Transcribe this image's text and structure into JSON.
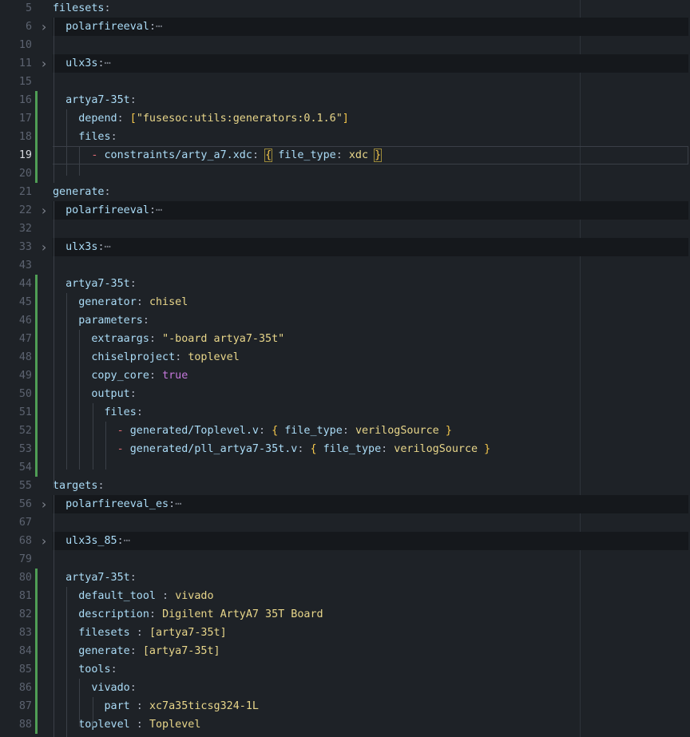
{
  "editor": {
    "lines": [
      {
        "num": "5",
        "tokens": [
          {
            "t": "key",
            "v": "filesets"
          },
          {
            "t": "punct",
            "v": ":"
          }
        ]
      },
      {
        "num": "6",
        "folded": true,
        "tokens": [
          {
            "t": "sp",
            "v": "  "
          },
          {
            "t": "key",
            "v": "polarfireeval"
          },
          {
            "t": "punct",
            "v": ":"
          },
          {
            "t": "ellipsis",
            "v": "⋯"
          }
        ]
      },
      {
        "num": "10",
        "tokens": []
      },
      {
        "num": "11",
        "folded": true,
        "tokens": [
          {
            "t": "sp",
            "v": "  "
          },
          {
            "t": "key",
            "v": "ulx3s"
          },
          {
            "t": "punct",
            "v": ":"
          },
          {
            "t": "ellipsis",
            "v": "⋯"
          }
        ]
      },
      {
        "num": "15",
        "tokens": []
      },
      {
        "num": "16",
        "tokens": [
          {
            "t": "sp",
            "v": "  "
          },
          {
            "t": "key",
            "v": "artya7-35t"
          },
          {
            "t": "punct",
            "v": ":"
          }
        ]
      },
      {
        "num": "17",
        "tokens": [
          {
            "t": "sp",
            "v": "    "
          },
          {
            "t": "key",
            "v": "depend"
          },
          {
            "t": "punct",
            "v": ": "
          },
          {
            "t": "brace",
            "v": "["
          },
          {
            "t": "str",
            "v": "\"fusesoc:utils:generators:0.1.6\""
          },
          {
            "t": "brace",
            "v": "]"
          }
        ]
      },
      {
        "num": "18",
        "tokens": [
          {
            "t": "sp",
            "v": "    "
          },
          {
            "t": "key",
            "v": "files"
          },
          {
            "t": "punct",
            "v": ":"
          }
        ]
      },
      {
        "num": "19",
        "current": true,
        "tokens": [
          {
            "t": "sp",
            "v": "      "
          },
          {
            "t": "dash",
            "v": "- "
          },
          {
            "t": "key",
            "v": "constraints/arty_a7.xdc"
          },
          {
            "t": "punct",
            "v": ": "
          },
          {
            "t": "bracebox",
            "v": "{"
          },
          {
            "t": "punct",
            "v": " "
          },
          {
            "t": "key",
            "v": "file_type"
          },
          {
            "t": "punct",
            "v": ": "
          },
          {
            "t": "val",
            "v": "xdc"
          },
          {
            "t": "punct",
            "v": " "
          },
          {
            "t": "bracebox",
            "v": "}"
          }
        ]
      },
      {
        "num": "20",
        "tokens": []
      },
      {
        "num": "21",
        "tokens": [
          {
            "t": "key",
            "v": "generate"
          },
          {
            "t": "punct",
            "v": ":"
          }
        ]
      },
      {
        "num": "22",
        "folded": true,
        "tokens": [
          {
            "t": "sp",
            "v": "  "
          },
          {
            "t": "key",
            "v": "polarfireeval"
          },
          {
            "t": "punct",
            "v": ":"
          },
          {
            "t": "ellipsis",
            "v": "⋯"
          }
        ]
      },
      {
        "num": "32",
        "tokens": []
      },
      {
        "num": "33",
        "folded": true,
        "tokens": [
          {
            "t": "sp",
            "v": "  "
          },
          {
            "t": "key",
            "v": "ulx3s"
          },
          {
            "t": "punct",
            "v": ":"
          },
          {
            "t": "ellipsis",
            "v": "⋯"
          }
        ]
      },
      {
        "num": "43",
        "tokens": []
      },
      {
        "num": "44",
        "tokens": [
          {
            "t": "sp",
            "v": "  "
          },
          {
            "t": "key",
            "v": "artya7-35t"
          },
          {
            "t": "punct",
            "v": ":"
          }
        ]
      },
      {
        "num": "45",
        "tokens": [
          {
            "t": "sp",
            "v": "    "
          },
          {
            "t": "key",
            "v": "generator"
          },
          {
            "t": "punct",
            "v": ": "
          },
          {
            "t": "val",
            "v": "chisel"
          }
        ]
      },
      {
        "num": "46",
        "tokens": [
          {
            "t": "sp",
            "v": "    "
          },
          {
            "t": "key",
            "v": "parameters"
          },
          {
            "t": "punct",
            "v": ":"
          }
        ]
      },
      {
        "num": "47",
        "tokens": [
          {
            "t": "sp",
            "v": "      "
          },
          {
            "t": "key",
            "v": "extraargs"
          },
          {
            "t": "punct",
            "v": ": "
          },
          {
            "t": "str",
            "v": "\"-board artya7-35t\""
          }
        ]
      },
      {
        "num": "48",
        "tokens": [
          {
            "t": "sp",
            "v": "      "
          },
          {
            "t": "key",
            "v": "chiselproject"
          },
          {
            "t": "punct",
            "v": ": "
          },
          {
            "t": "val",
            "v": "toplevel"
          }
        ]
      },
      {
        "num": "49",
        "tokens": [
          {
            "t": "sp",
            "v": "      "
          },
          {
            "t": "key",
            "v": "copy_core"
          },
          {
            "t": "punct",
            "v": ": "
          },
          {
            "t": "bool",
            "v": "true"
          }
        ]
      },
      {
        "num": "50",
        "tokens": [
          {
            "t": "sp",
            "v": "      "
          },
          {
            "t": "key",
            "v": "output"
          },
          {
            "t": "punct",
            "v": ":"
          }
        ]
      },
      {
        "num": "51",
        "tokens": [
          {
            "t": "sp",
            "v": "        "
          },
          {
            "t": "key",
            "v": "files"
          },
          {
            "t": "punct",
            "v": ":"
          }
        ]
      },
      {
        "num": "52",
        "tokens": [
          {
            "t": "sp",
            "v": "          "
          },
          {
            "t": "dash",
            "v": "- "
          },
          {
            "t": "key",
            "v": "generated/Toplevel.v"
          },
          {
            "t": "punct",
            "v": ": "
          },
          {
            "t": "brace",
            "v": "{"
          },
          {
            "t": "punct",
            "v": " "
          },
          {
            "t": "key",
            "v": "file_type"
          },
          {
            "t": "punct",
            "v": ": "
          },
          {
            "t": "val",
            "v": "verilogSource"
          },
          {
            "t": "punct",
            "v": " "
          },
          {
            "t": "brace",
            "v": "}"
          }
        ]
      },
      {
        "num": "53",
        "tokens": [
          {
            "t": "sp",
            "v": "          "
          },
          {
            "t": "dash",
            "v": "- "
          },
          {
            "t": "key",
            "v": "generated/pll_artya7-35t.v"
          },
          {
            "t": "punct",
            "v": ": "
          },
          {
            "t": "brace",
            "v": "{"
          },
          {
            "t": "punct",
            "v": " "
          },
          {
            "t": "key",
            "v": "file_type"
          },
          {
            "t": "punct",
            "v": ": "
          },
          {
            "t": "val",
            "v": "verilogSource"
          },
          {
            "t": "punct",
            "v": " "
          },
          {
            "t": "brace",
            "v": "}"
          }
        ]
      },
      {
        "num": "54",
        "tokens": []
      },
      {
        "num": "55",
        "tokens": [
          {
            "t": "key",
            "v": "targets"
          },
          {
            "t": "punct",
            "v": ":"
          }
        ]
      },
      {
        "num": "56",
        "folded": true,
        "tokens": [
          {
            "t": "sp",
            "v": "  "
          },
          {
            "t": "key",
            "v": "polarfireeval_es"
          },
          {
            "t": "punct",
            "v": ":"
          },
          {
            "t": "ellipsis",
            "v": "⋯"
          }
        ]
      },
      {
        "num": "67",
        "tokens": []
      },
      {
        "num": "68",
        "folded": true,
        "tokens": [
          {
            "t": "sp",
            "v": "  "
          },
          {
            "t": "key",
            "v": "ulx3s_85"
          },
          {
            "t": "punct",
            "v": ":"
          },
          {
            "t": "ellipsis",
            "v": "⋯"
          }
        ]
      },
      {
        "num": "79",
        "tokens": []
      },
      {
        "num": "80",
        "tokens": [
          {
            "t": "sp",
            "v": "  "
          },
          {
            "t": "key",
            "v": "artya7-35t"
          },
          {
            "t": "punct",
            "v": ":"
          }
        ]
      },
      {
        "num": "81",
        "tokens": [
          {
            "t": "sp",
            "v": "    "
          },
          {
            "t": "key",
            "v": "default_tool"
          },
          {
            "t": "punct",
            "v": " : "
          },
          {
            "t": "val",
            "v": "vivado"
          }
        ]
      },
      {
        "num": "82",
        "tokens": [
          {
            "t": "sp",
            "v": "    "
          },
          {
            "t": "key",
            "v": "description"
          },
          {
            "t": "punct",
            "v": ": "
          },
          {
            "t": "val",
            "v": "Digilent ArtyA7 35T Board"
          }
        ]
      },
      {
        "num": "83",
        "tokens": [
          {
            "t": "sp",
            "v": "    "
          },
          {
            "t": "key",
            "v": "filesets"
          },
          {
            "t": "punct",
            "v": " : "
          },
          {
            "t": "val",
            "v": "[artya7-35t]"
          }
        ]
      },
      {
        "num": "84",
        "tokens": [
          {
            "t": "sp",
            "v": "    "
          },
          {
            "t": "key",
            "v": "generate"
          },
          {
            "t": "punct",
            "v": ": "
          },
          {
            "t": "val",
            "v": "[artya7-35t]"
          }
        ]
      },
      {
        "num": "85",
        "tokens": [
          {
            "t": "sp",
            "v": "    "
          },
          {
            "t": "key",
            "v": "tools"
          },
          {
            "t": "punct",
            "v": ":"
          }
        ]
      },
      {
        "num": "86",
        "tokens": [
          {
            "t": "sp",
            "v": "      "
          },
          {
            "t": "key",
            "v": "vivado"
          },
          {
            "t": "punct",
            "v": ":"
          }
        ]
      },
      {
        "num": "87",
        "tokens": [
          {
            "t": "sp",
            "v": "        "
          },
          {
            "t": "key",
            "v": "part"
          },
          {
            "t": "punct",
            "v": " : "
          },
          {
            "t": "val",
            "v": "xc7a35ticsg324-1L"
          }
        ]
      },
      {
        "num": "88",
        "tokens": [
          {
            "t": "sp",
            "v": "    "
          },
          {
            "t": "key",
            "v": "toplevel"
          },
          {
            "t": "punct",
            "v": " : "
          },
          {
            "t": "val",
            "v": "Toplevel"
          }
        ]
      }
    ],
    "colors": {
      "background": "#1e2227",
      "key": "#abdcf7",
      "value": "#e8d68a",
      "boolean": "#c678dd",
      "brace": "#f5c84c",
      "dash": "#e06c75",
      "git_added": "#4f9e55",
      "line_number": "#5c6370"
    },
    "icons": {
      "fold_collapsed": "chevron-right-icon"
    }
  }
}
